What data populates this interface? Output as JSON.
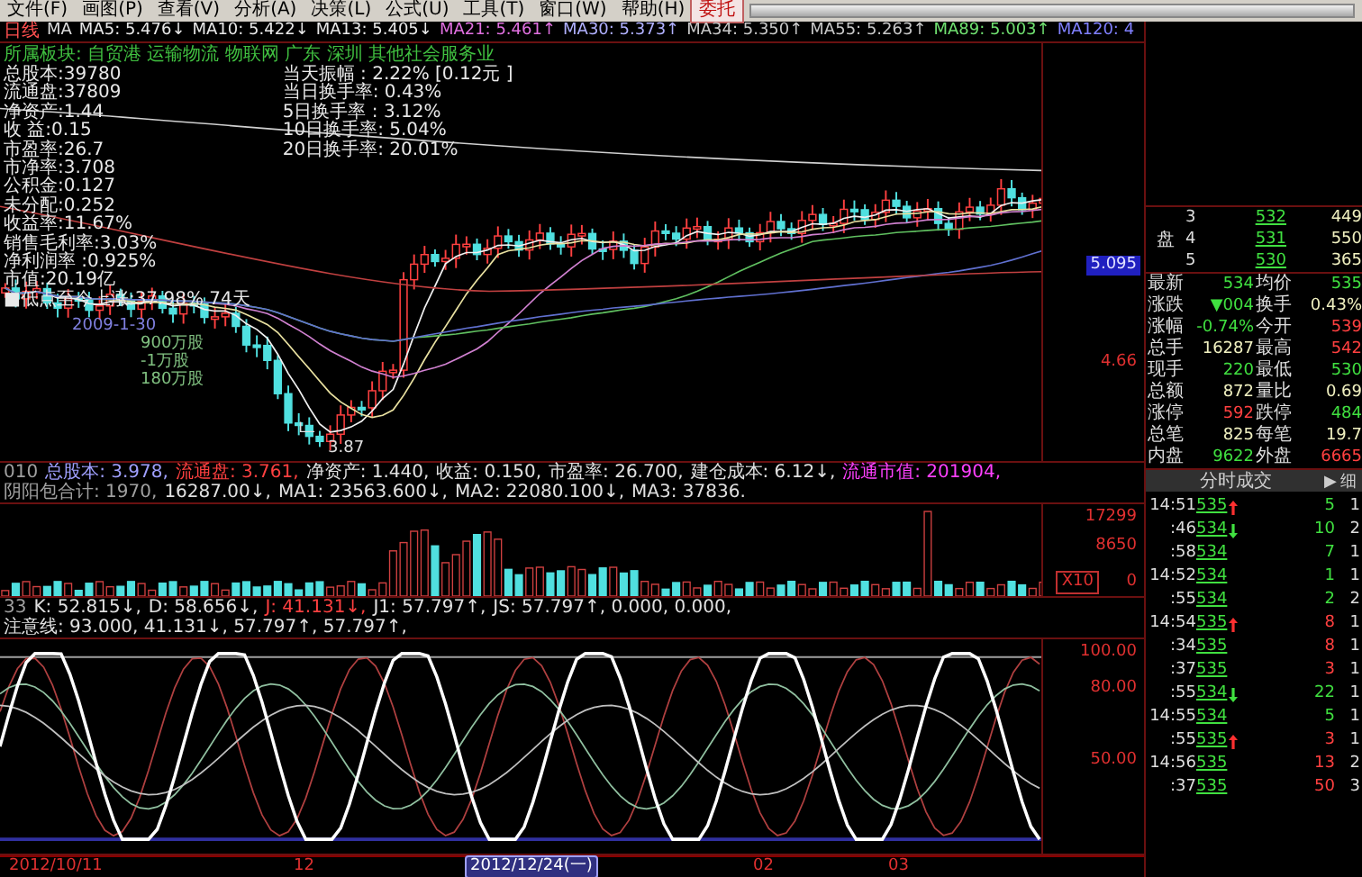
{
  "menu": [
    {
      "label": "文件(F)",
      "kind": "menu"
    },
    {
      "label": "画图(P)",
      "kind": "menu"
    },
    {
      "label": "查看(V)",
      "kind": "menu"
    },
    {
      "label": "分析(A)",
      "kind": "menu"
    },
    {
      "label": "决策(L)",
      "kind": "menu"
    },
    {
      "label": "公式(U)",
      "kind": "menu"
    },
    {
      "label": "工具(T)",
      "kind": "menu"
    },
    {
      "label": "窗口(W)",
      "kind": "menu"
    },
    {
      "label": "帮助(H)",
      "kind": "menu"
    },
    {
      "label": "委托",
      "kind": "button"
    }
  ],
  "ma_line": {
    "period": "日线",
    "prefix": "MA",
    "items": [
      "MA5: 5.476↓",
      "MA10: 5.422↓",
      "MA13: 5.405↓",
      "MA21: 5.461↑",
      "MA30: 5.373↑",
      "MA34: 5.350↑",
      "MA55: 5.263↑",
      "MA89: 5.003↑",
      "MA120: 4"
    ]
  },
  "sector": "所属板块: 自贸港 运输物流 物联网 广东 深圳 其他社会服务业",
  "stats_left": [
    "总股本:39780",
    "流通盘:37809",
    "净资产:1.44",
    "收  益:0.15",
    "市盈率:26.7",
    "市净率:3.708",
    "公积金:0.127",
    "未分配:0.252",
    "收益率:11.67%",
    "销售毛利率:3.03%",
    "净利润率 :0.925%",
    "市值:20.19亿",
    "■低点至今上涨:37.98%  74天"
  ],
  "stats_right": [
    "当天振幅  : 2.22% [0.12元 ]",
    "当日换手率: 0.43%",
    "5日换手率 : 3.12%",
    "10日换手率: 5.04%",
    "20日换手率: 20.01%"
  ],
  "chart_labels": [
    "2009-1-30",
    "900万股",
    "-1万股",
    "180万股"
  ],
  "low_marker": "3.87",
  "price_axis": [
    {
      "text": "5.095",
      "selected": true
    },
    {
      "text": "4.66",
      "selected": false
    }
  ],
  "indicator_line": [
    "010",
    "总股本: 3.978,",
    "流通盘: 3.761,",
    "净资产: 1.440,",
    "收益: 0.150,",
    "市盈率: 26.700,",
    "建仓成本: 6.12↓,",
    "流通市值: 201904,",
    "阴阳包合计: 1970,",
    "16287.00↓,",
    "MA1: 23563.600↓,",
    "MA2: 22080.100↓,",
    "MA3: 37836."
  ],
  "volume_axis": [
    "17299",
    "8650",
    "X10",
    "0"
  ],
  "kdj_line": [
    "33",
    "K: 52.815↓,",
    "D: 58.656↓,",
    "J: 41.131↓,",
    "J1: 57.797↑,",
    "JS: 57.797↑, 0.000, 0.000,",
    "注意线: 93.000, 41.131↓, 57.797↑, 57.797↑,"
  ],
  "kdj_axis": [
    "100.00",
    "80.00",
    "50.00"
  ],
  "dates": [
    {
      "label": "2012/10/11",
      "selected": false
    },
    {
      "label": "12",
      "selected": false
    },
    {
      "label": "2012/12/24(一)",
      "selected": true
    },
    {
      "label": "02",
      "selected": false
    },
    {
      "label": "03",
      "selected": false
    }
  ],
  "order_book": {
    "side": "盘",
    "rows": [
      {
        "level": "3",
        "price": "532",
        "volume": "449"
      },
      {
        "level": "4",
        "price": "531",
        "volume": "550"
      },
      {
        "level": "5",
        "price": "530",
        "volume": "365"
      }
    ]
  },
  "quotes": [
    {
      "cells": [
        {
          "label": "最新",
          "value": "534",
          "color": "#40e040"
        },
        {
          "label": "均价",
          "value": "535",
          "color": "#40e040"
        }
      ]
    },
    {
      "cells": [
        {
          "label": "涨跌",
          "value": "▼004",
          "color": "#40e040"
        },
        {
          "label": "换手",
          "value": "0.43%",
          "color": "#f0f0c0"
        }
      ]
    },
    {
      "cells": [
        {
          "label": "涨幅",
          "value": "-0.74%",
          "color": "#40e040"
        },
        {
          "label": "今开",
          "value": "539",
          "color": "#ff4040"
        }
      ]
    },
    {
      "cells": [
        {
          "label": "总手",
          "value": "16287",
          "color": "#f0f0c0"
        },
        {
          "label": "最高",
          "value": "542",
          "color": "#ff4040"
        }
      ]
    },
    {
      "cells": [
        {
          "label": "现手",
          "value": "220",
          "color": "#40e040"
        },
        {
          "label": "最低",
          "value": "530",
          "color": "#40e040"
        }
      ]
    },
    {
      "cells": [
        {
          "label": "总额",
          "value": "872",
          "color": "#f0f0c0"
        },
        {
          "label": "量比",
          "value": "0.69",
          "color": "#f0f0c0"
        }
      ]
    },
    {
      "cells": [
        {
          "label": "涨停",
          "value": "592",
          "color": "#ff4040"
        },
        {
          "label": "跌停",
          "value": "484",
          "color": "#40e040"
        }
      ]
    },
    {
      "cells": [
        {
          "label": "总笔",
          "value": "825",
          "color": "#f0f0c0"
        },
        {
          "label": "每笔",
          "value": "19.7",
          "color": "#f0f0c0"
        }
      ]
    },
    {
      "cells": [
        {
          "label": "内盘",
          "value": "9622",
          "color": "#40e040"
        },
        {
          "label": "外盘",
          "value": "6665",
          "color": "#ff4040"
        }
      ]
    }
  ],
  "trades_header": {
    "title": "分时成交",
    "arrow": "▶",
    "detail": "细"
  },
  "trades": [
    {
      "time": "14:51",
      "price": "535",
      "kind": "up",
      "volume": "5",
      "color": "#40e040",
      "count": "1"
    },
    {
      "time": ":46",
      "price": "534",
      "kind": "down",
      "volume": "10",
      "color": "#40e040",
      "count": "2"
    },
    {
      "time": ":58",
      "price": "534",
      "kind": "flat",
      "volume": "7",
      "color": "#40e040",
      "count": "1"
    },
    {
      "time": "14:52",
      "price": "534",
      "kind": "flat",
      "volume": "1",
      "color": "#40e040",
      "count": "1"
    },
    {
      "time": ":55",
      "price": "534",
      "kind": "flat",
      "volume": "2",
      "color": "#40e040",
      "count": "2"
    },
    {
      "time": "14:54",
      "price": "535",
      "kind": "up",
      "volume": "8",
      "color": "#ff4040",
      "count": "1"
    },
    {
      "time": ":34",
      "price": "535",
      "kind": "flat",
      "volume": "8",
      "color": "#ff4040",
      "count": "1"
    },
    {
      "time": ":37",
      "price": "535",
      "kind": "flat",
      "volume": "3",
      "color": "#ff4040",
      "count": "1"
    },
    {
      "time": ":55",
      "price": "534",
      "kind": "down",
      "volume": "22",
      "color": "#40e040",
      "count": "1"
    },
    {
      "time": "14:55",
      "price": "534",
      "kind": "flat",
      "volume": "5",
      "color": "#40e040",
      "count": "1"
    },
    {
      "time": ":55",
      "price": "535",
      "kind": "up",
      "volume": "3",
      "color": "#ff4040",
      "count": "1"
    },
    {
      "time": "14:56",
      "price": "535",
      "kind": "flat",
      "volume": "13",
      "color": "#ff4040",
      "count": "2"
    },
    {
      "time": ":37",
      "price": "535",
      "kind": "flat",
      "volume": "50",
      "color": "#ff4040",
      "count": "3"
    }
  ]
}
